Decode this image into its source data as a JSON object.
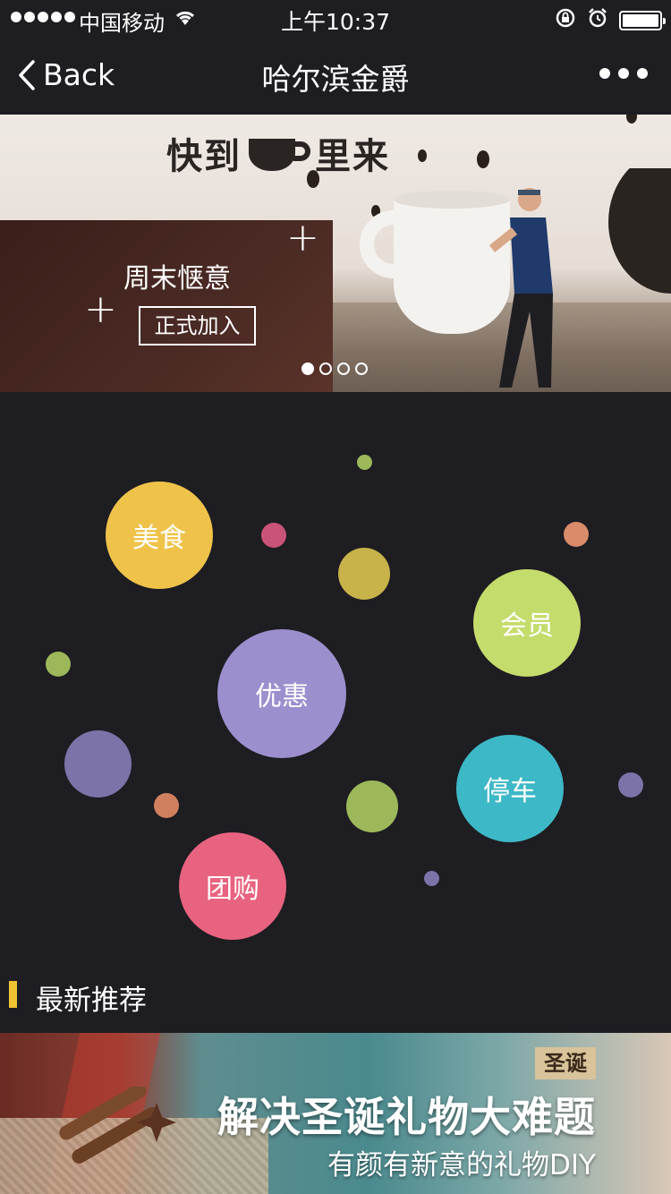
{
  "status_bar": {
    "carrier": "中国移动",
    "time": "上午10:37"
  },
  "nav": {
    "back_label": "Back",
    "title": "哈尔滨金爵",
    "more_icon": "ellipsis-icon"
  },
  "banner": {
    "logo_text_left": "快到",
    "logo_text_right": "里来",
    "headline": "周末惬意",
    "cta_label": "正式加入",
    "page_count": 4,
    "active_page": 1
  },
  "menu": [
    {
      "label": "美食",
      "color": "#efc34a"
    },
    {
      "label": "会员",
      "color": "#c4dc6c"
    },
    {
      "label": "优惠",
      "color": "#9d8fce"
    },
    {
      "label": "停车",
      "color": "#3db8c7"
    },
    {
      "label": "团购",
      "color": "#e8637f"
    }
  ],
  "recommend": {
    "section_title": "最新推荐",
    "accent_color": "#f1c232",
    "promo": {
      "tag": "圣诞",
      "title": "解决圣诞礼物大难题",
      "subtitle": "有颜有新意的礼物DIY"
    }
  }
}
